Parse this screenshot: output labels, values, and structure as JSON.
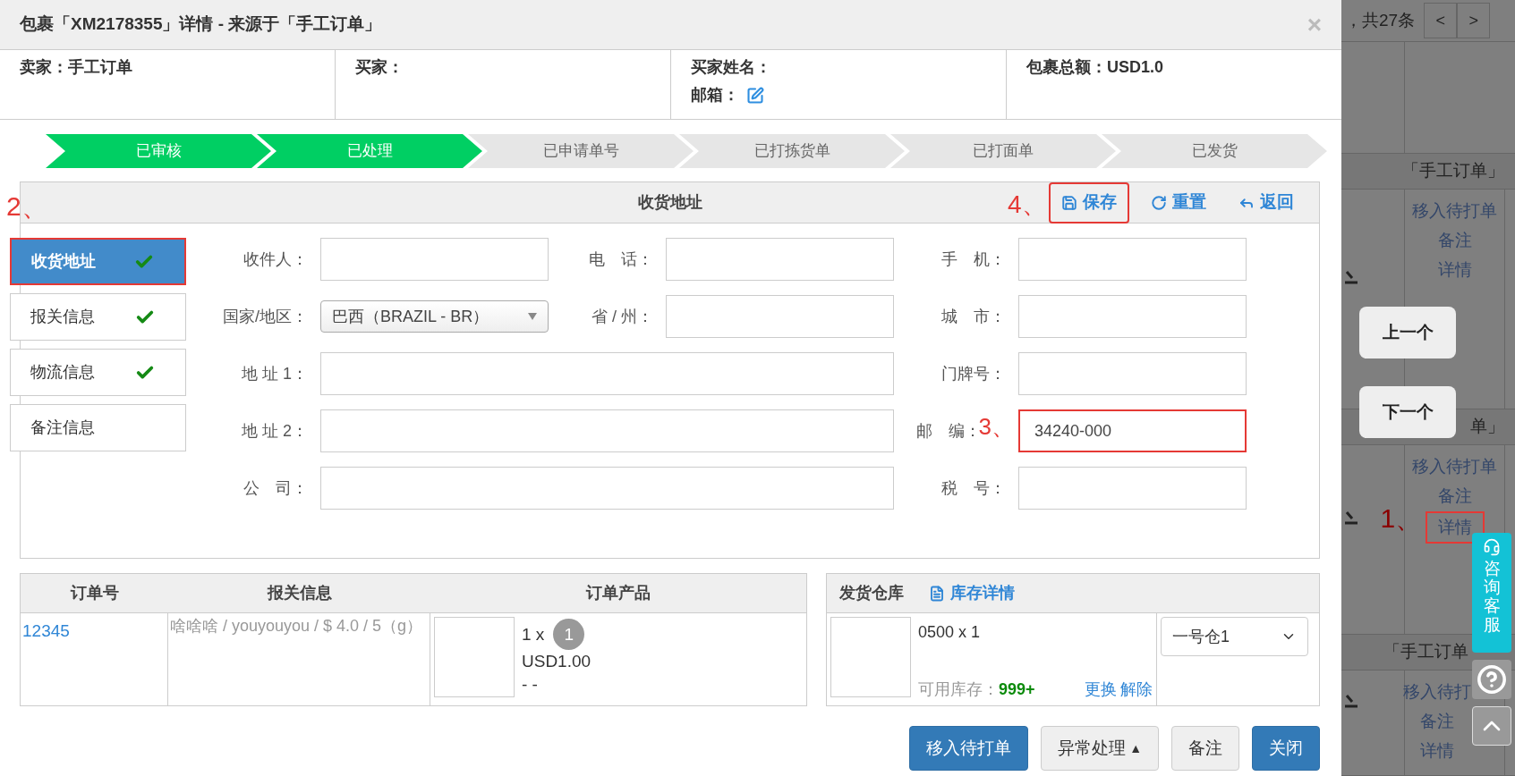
{
  "dialog": {
    "title": "包裹「XM2178355」详情 - 来源于「手工订单」",
    "close": "×"
  },
  "info": [
    {
      "lines": [
        {
          "text": "卖家：手工订单"
        }
      ]
    },
    {
      "lines": [
        {
          "text": "买家："
        }
      ]
    },
    {
      "lines": [
        {
          "text": "买家姓名："
        },
        {
          "text": "邮箱：",
          "editable": true
        }
      ]
    },
    {
      "lines": [
        {
          "text": "包裹总额：USD1.0"
        }
      ]
    }
  ],
  "steps": [
    {
      "label": "已审核",
      "done": true
    },
    {
      "label": "已处理",
      "done": true
    },
    {
      "label": "已申请单号",
      "done": false
    },
    {
      "label": "已打拣货单",
      "done": false
    },
    {
      "label": "已打面单",
      "done": false
    },
    {
      "label": "已发货",
      "done": false
    }
  ],
  "panel": {
    "title": "收货地址",
    "actions": [
      {
        "label": "保存",
        "kind": "save",
        "highlighted": true,
        "annotation": "4、"
      },
      {
        "label": "重置",
        "kind": "reset",
        "highlighted": false
      },
      {
        "label": "返回",
        "kind": "back",
        "highlighted": false
      }
    ],
    "tabs": [
      {
        "label": "收货地址",
        "selected": true,
        "complete": true,
        "highlighted": true,
        "annotation": "2、"
      },
      {
        "label": "报关信息",
        "selected": false,
        "complete": true,
        "highlighted": false
      },
      {
        "label": "物流信息",
        "selected": false,
        "complete": true,
        "highlighted": false
      },
      {
        "label": "备注信息",
        "selected": false,
        "complete": false,
        "highlighted": false
      }
    ],
    "fields": [
      {
        "label": "收件人：",
        "kind": "text"
      },
      {
        "label": "电　话：",
        "kind": "text"
      },
      {
        "label": "手　机：",
        "kind": "text"
      },
      {
        "label": "国家/地区：",
        "kind": "select",
        "value": "巴西（BRAZIL - BR）"
      },
      {
        "label": "省 / 州：",
        "kind": "text"
      },
      {
        "label": "城　市：",
        "kind": "text"
      },
      {
        "label": "地 址 1：",
        "kind": "wide"
      },
      {
        "label": "门牌号：",
        "kind": "text"
      },
      {
        "label": "地 址 2：",
        "kind": "wide"
      },
      {
        "label": "邮　编：",
        "kind": "text",
        "value": "34240-000",
        "highlighted": true,
        "annotation": "3、"
      },
      {
        "label": "公　司：",
        "kind": "wide"
      },
      {
        "label": "税　号：",
        "kind": "text"
      }
    ]
  },
  "orders": {
    "columns": [
      "订单号",
      "报关信息",
      "订单产品"
    ],
    "rows": [
      {
        "order_no": "12345",
        "customs": "啥啥啥 / youyouyou / $ 4.0 / 5（g）",
        "quantity": "1 x",
        "badge": "1",
        "price": "USD1.00",
        "note": "- -"
      }
    ]
  },
  "warehouse": {
    "title": "发货仓库",
    "link": "库存详情",
    "item": "0500 x 1",
    "stock_label": "可用库存：",
    "stock": "999+",
    "actions": [
      "更换",
      "解除"
    ],
    "select": "一号仓1"
  },
  "footer_buttons": [
    {
      "label": "移入待打单",
      "kind": "primary"
    },
    {
      "label": "异常处理",
      "kind": "dropdown",
      "caret": "▲"
    },
    {
      "label": "备注",
      "kind": "default"
    },
    {
      "label": "关闭",
      "kind": "primary"
    }
  ],
  "background": {
    "pager_text": "，共27条",
    "pager_buttons": [
      "<",
      ">"
    ],
    "sections": [
      {
        "header": "「手工订单」",
        "actions": [
          {
            "label": "移入待打单"
          },
          {
            "label": "备注"
          },
          {
            "label": "详情"
          }
        ]
      },
      {
        "header": "单」",
        "actions": [
          {
            "label": "移入待打单"
          },
          {
            "label": "备注"
          },
          {
            "label": "详情",
            "annotation": "1、"
          }
        ]
      },
      {
        "header": "「手工订单",
        "actions": [
          {
            "label": "移入待打"
          },
          {
            "label": "备注"
          },
          {
            "label": "详情"
          }
        ]
      }
    ]
  },
  "nav_buttons": [
    "上一个",
    "下一个"
  ],
  "support": {
    "label": "咨询客服"
  }
}
